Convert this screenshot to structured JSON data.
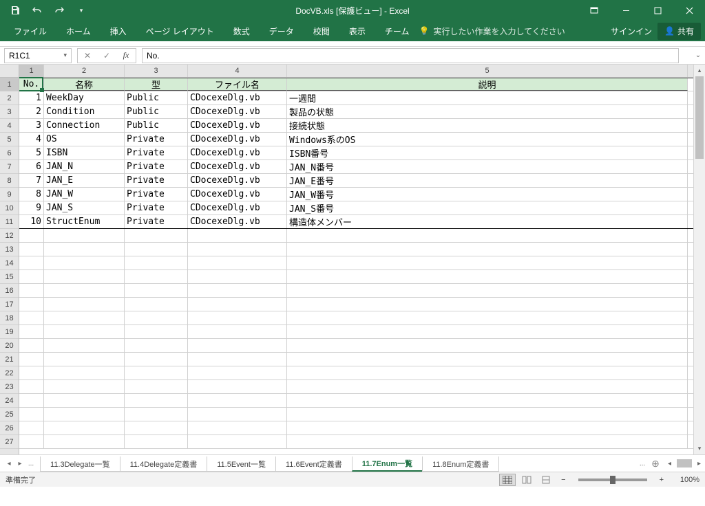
{
  "title": "DocVB.xls  [保護ビュー] - Excel",
  "qat": {
    "save": "保存",
    "undo": "元に戻す",
    "redo": "やり直し"
  },
  "ribbon": {
    "tabs": [
      "ファイル",
      "ホーム",
      "挿入",
      "ページ レイアウト",
      "数式",
      "データ",
      "校閲",
      "表示",
      "チーム"
    ],
    "tell_me": "実行したい作業を入力してください",
    "signin": "サインイン",
    "share": "共有"
  },
  "name_box": "R1C1",
  "formula": "No.",
  "columns": [
    "1",
    "2",
    "3",
    "4",
    "5"
  ],
  "headers": {
    "no": "No.",
    "name": "名称",
    "type": "型",
    "file": "ファイル名",
    "desc": "説明"
  },
  "rows": [
    {
      "no": "1",
      "name": "WeekDay",
      "type": "Public",
      "file": "CDocexeDlg.vb",
      "desc": "一週間"
    },
    {
      "no": "2",
      "name": "Condition",
      "type": "Public",
      "file": "CDocexeDlg.vb",
      "desc": "製品の状態"
    },
    {
      "no": "3",
      "name": "Connection",
      "type": "Public",
      "file": "CDocexeDlg.vb",
      "desc": "接続状態"
    },
    {
      "no": "4",
      "name": "OS",
      "type": "Private",
      "file": "CDocexeDlg.vb",
      "desc": "Windows系のOS"
    },
    {
      "no": "5",
      "name": "ISBN",
      "type": "Private",
      "file": "CDocexeDlg.vb",
      "desc": "ISBN番号"
    },
    {
      "no": "6",
      "name": "JAN_N",
      "type": "Private",
      "file": "CDocexeDlg.vb",
      "desc": "JAN_N番号"
    },
    {
      "no": "7",
      "name": "JAN_E",
      "type": "Private",
      "file": "CDocexeDlg.vb",
      "desc": "JAN_E番号"
    },
    {
      "no": "8",
      "name": "JAN_W",
      "type": "Private",
      "file": "CDocexeDlg.vb",
      "desc": "JAN_W番号"
    },
    {
      "no": "9",
      "name": "JAN_S",
      "type": "Private",
      "file": "CDocexeDlg.vb",
      "desc": "JAN_S番号"
    },
    {
      "no": "10",
      "name": "StructEnum",
      "type": "Private",
      "file": "CDocexeDlg.vb",
      "desc": "構造体メンバー"
    }
  ],
  "sheet_tabs": {
    "items": [
      "11.3Delegate一覧",
      "11.4Delegate定義書",
      "11.5Event一覧",
      "11.6Event定義書",
      "11.7Enum一覧",
      "11.8Enum定義書"
    ],
    "active": 4,
    "more_left": "...",
    "more_right": "..."
  },
  "status": {
    "ready": "準備完了",
    "zoom": "100%"
  }
}
